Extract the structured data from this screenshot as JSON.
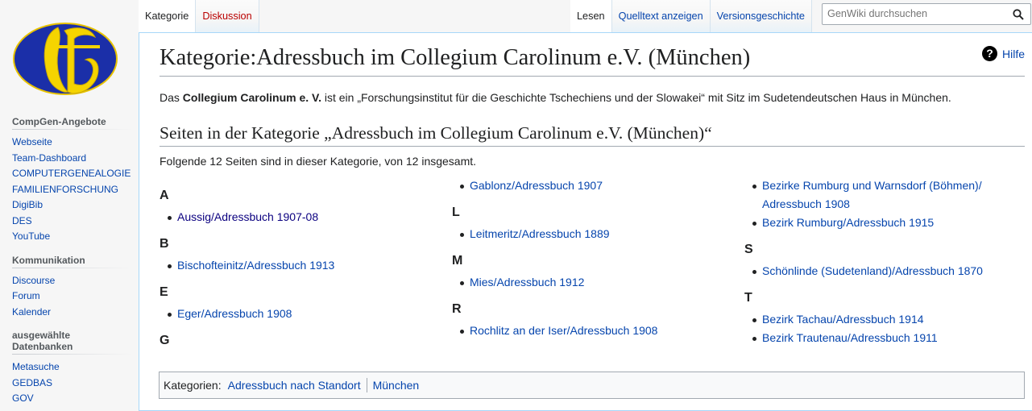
{
  "tabs": {
    "left": [
      {
        "label": "Kategorie",
        "selected": true,
        "red": false
      },
      {
        "label": "Diskussion",
        "selected": false,
        "red": true
      }
    ],
    "right": [
      {
        "label": "Lesen",
        "selected": true
      },
      {
        "label": "Quelltext anzeigen",
        "selected": false
      },
      {
        "label": "Versionsgeschichte",
        "selected": false
      }
    ]
  },
  "search": {
    "placeholder": "GenWiki durchsuchen"
  },
  "sidebar": {
    "sections": [
      {
        "title": "CompGen-Angebote",
        "items": [
          "Webseite",
          "Team-Dashboard",
          "COMPUTERGENEALOGIE",
          "FAMILIENFORSCHUNG",
          "DigiBib",
          "DES",
          "YouTube"
        ]
      },
      {
        "title": "Kommunikation",
        "items": [
          "Discourse",
          "Forum",
          "Kalender"
        ]
      },
      {
        "title": "ausgewählte Datenbanken",
        "items": [
          "Metasuche",
          "GEDBAS",
          "GOV"
        ]
      }
    ]
  },
  "help": {
    "label": "Hilfe"
  },
  "page": {
    "title": "Kategorie:Adressbuch im Collegium Carolinum e.V. (München)",
    "intro_prefix": "Das ",
    "intro_bold": "Collegium Carolinum e. V.",
    "intro_suffix": " ist ein „Forschungsinstitut für die Geschichte Tschechiens und der Slowakei“ mit Sitz im Sudetendeutschen Haus in München.",
    "section_heading": "Seiten in der Kategorie „Adressbuch im Collegium Carolinum e.V. (München)“",
    "count_text": "Folgende 12 Seiten sind in dieser Kategorie, von 12 insgesamt."
  },
  "columns": [
    [
      {
        "letter": "A",
        "items": [
          {
            "text": "Aussig/Adressbuch 1907-08",
            "visited": true
          }
        ]
      },
      {
        "letter": "B",
        "items": [
          {
            "text": "Bischofteinitz/Adressbuch 1913",
            "visited": false
          }
        ]
      },
      {
        "letter": "E",
        "items": [
          {
            "text": "Eger/Adressbuch 1908",
            "visited": false
          }
        ]
      },
      {
        "letter": "G",
        "items": []
      }
    ],
    [
      {
        "letter": "",
        "items": [
          {
            "text": "Gablonz/Adressbuch 1907",
            "visited": false
          }
        ]
      },
      {
        "letter": "L",
        "items": [
          {
            "text": "Leitmeritz/Adressbuch 1889",
            "visited": false
          }
        ]
      },
      {
        "letter": "M",
        "items": [
          {
            "text": "Mies/Adressbuch 1912",
            "visited": false
          }
        ]
      },
      {
        "letter": "R",
        "items": [
          {
            "text": "Rochlitz an der Iser/Adressbuch 1908",
            "visited": false
          }
        ]
      }
    ],
    [
      {
        "letter": "",
        "items": [
          {
            "text": "Bezirke Rumburg und Warnsdorf (Böhmen)/ Adressbuch 1908",
            "visited": false
          },
          {
            "text": "Bezirk Rumburg/Adressbuch 1915",
            "visited": false
          }
        ]
      },
      {
        "letter": "S",
        "items": [
          {
            "text": "Schönlinde (Sudetenland)/Adressbuch 1870",
            "visited": false
          }
        ]
      },
      {
        "letter": "T",
        "items": [
          {
            "text": "Bezirk Tachau/Adressbuch 1914",
            "visited": false
          },
          {
            "text": "Bezirk Trautenau/Adressbuch 1911",
            "visited": false
          }
        ]
      }
    ]
  ],
  "catlinks": {
    "label": "Kategorien",
    "items": [
      "Adressbuch nach Standort",
      "München"
    ]
  }
}
